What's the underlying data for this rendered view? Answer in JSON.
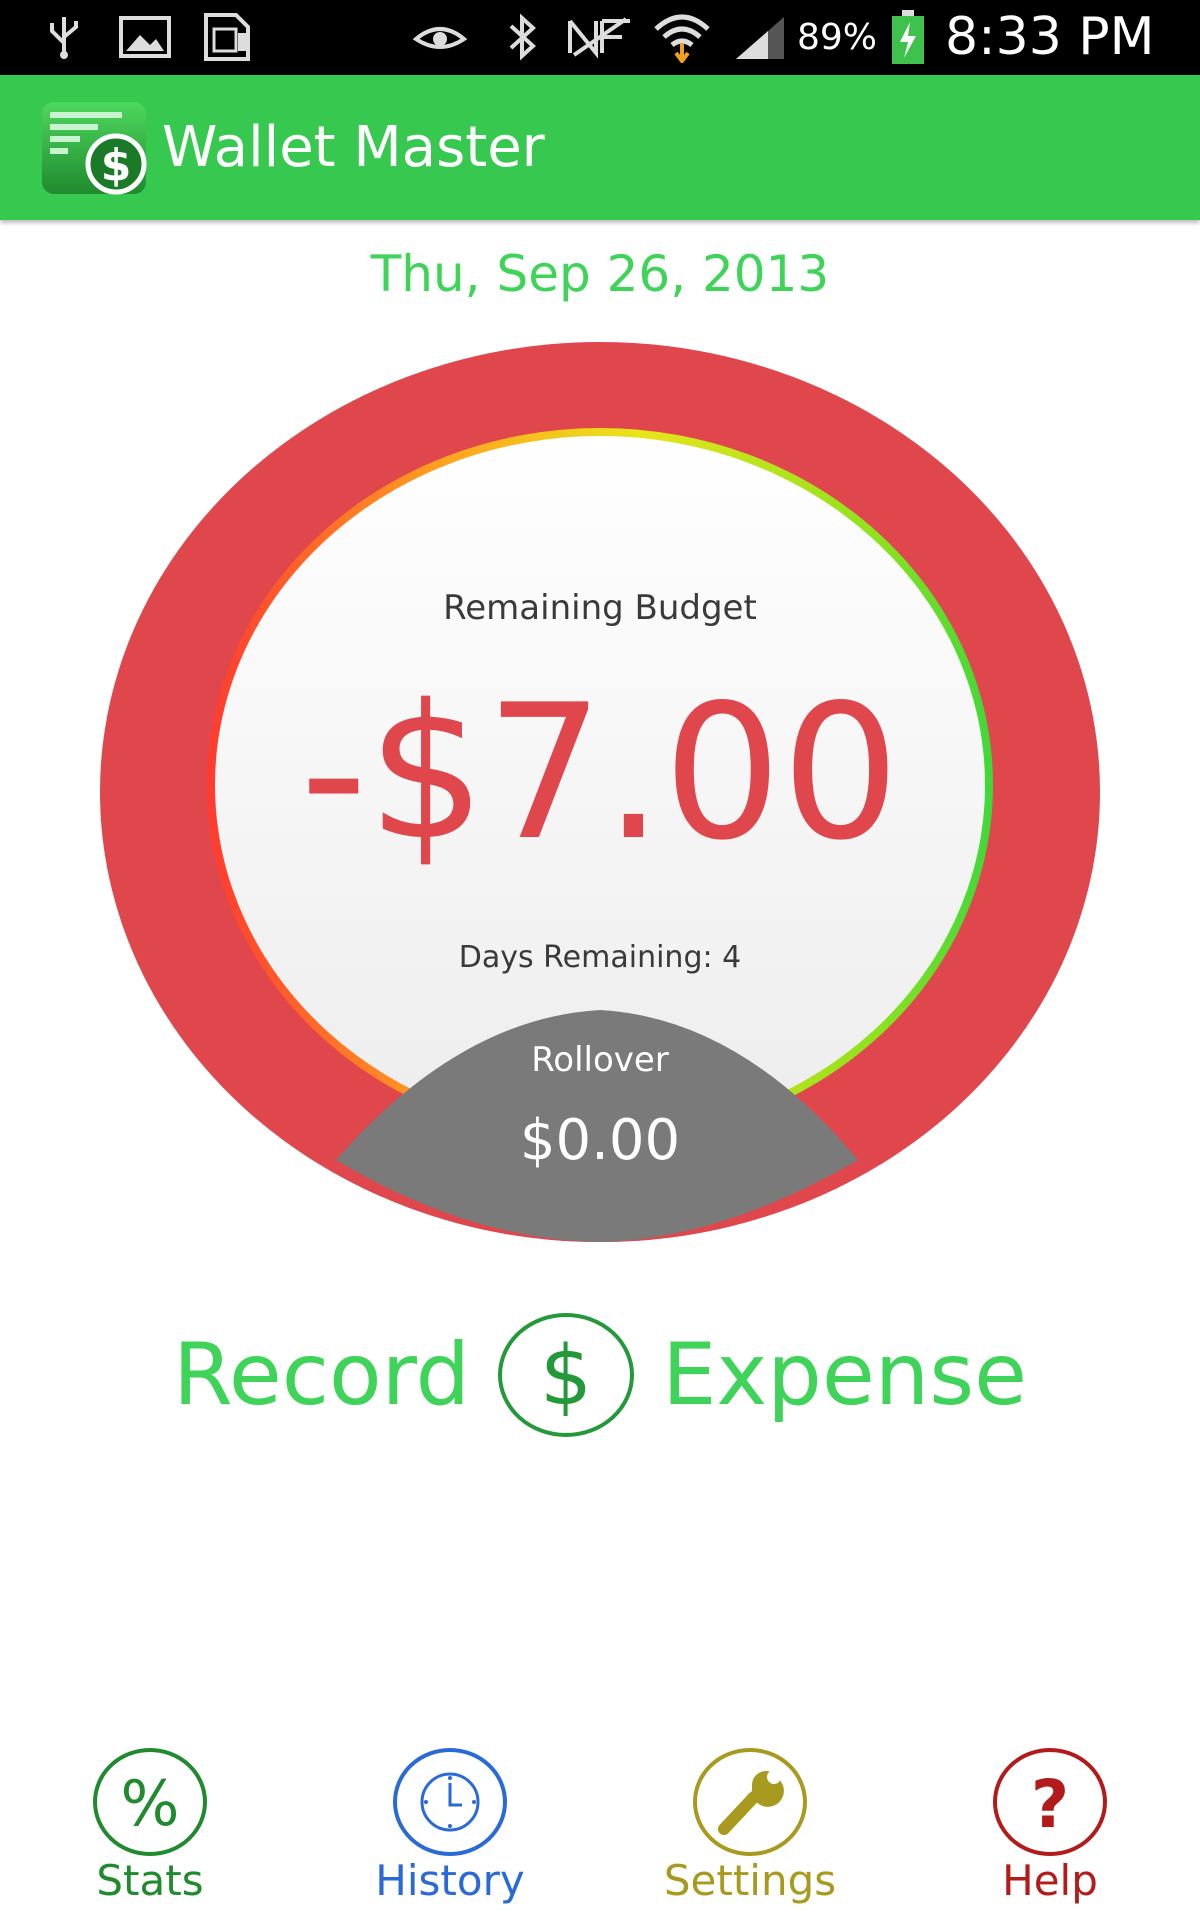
{
  "status_bar": {
    "battery": "89%",
    "time": "8:33 PM",
    "icons": [
      "usb-icon",
      "image-icon",
      "sim-icon",
      "eye-icon",
      "bluetooth-icon",
      "nfc-icon",
      "wifi-icon",
      "signal-icon",
      "battery-charging-icon"
    ]
  },
  "app": {
    "title": "Wallet Master",
    "brand_color": "#37c94f",
    "accent_text_color": "#3fd35a"
  },
  "date": "Thu, Sep 26, 2013",
  "budget": {
    "label": "Remaining Budget",
    "amount": "-$7.00",
    "amount_color": "#e0474c",
    "days_remaining_text": "Days Remaining: 4",
    "rollover_label": "Rollover",
    "rollover_amount": "$0.00",
    "ring_color": "#e0474c",
    "rollover_color": "#7a7a7a"
  },
  "record_expense": {
    "left_word": "Record",
    "right_word": "Expense",
    "icon": "dollar-circle-icon"
  },
  "bottom_nav": [
    {
      "label": "Stats",
      "icon": "percent-icon",
      "color": "#1f8a2e"
    },
    {
      "label": "History",
      "icon": "clock-icon",
      "color": "#2a6ad8"
    },
    {
      "label": "Settings",
      "icon": "wrench-icon",
      "color": "#a89a1e"
    },
    {
      "label": "Help",
      "icon": "question-icon",
      "color": "#b31b1b"
    }
  ]
}
